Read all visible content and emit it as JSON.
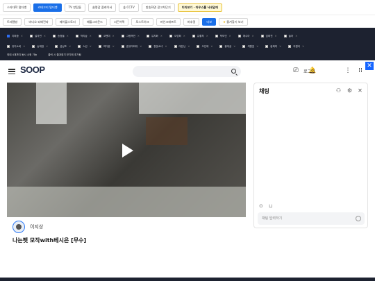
{
  "toolbar_top": {
    "buttons": [
      "스타대학 털더뱅",
      "카테고리 털더뱅",
      "TV 방탐들",
      "솔명감 플레이서",
      "숲 CCTV",
      "방송화면 광고차단기",
      "미리보기 · 마우스를 닉네임에"
    ]
  },
  "toolbar_second": {
    "buttons": [
      "트레젤방",
      "비디오 되배전자",
      "메이플스토리",
      "배틀그라운드",
      "서든어택",
      "로스트아크",
      "마인크래프트",
      "버추얼",
      "더보"
    ],
    "favorites_label": "즐겨찾기 보기"
  },
  "filter_panel": {
    "row1": [
      "지희중",
      "설국연",
      "송정들",
      "막리숲",
      "코밴미",
      "그림백연",
      "유지화",
      "오영희",
      "유좋처",
      "박보인",
      "에수아",
      "임희천",
      "솔아"
    ],
    "row2": [
      "유지소비",
      "송재현",
      "곰냥조",
      "스씬",
      "여다윤",
      "효유미와대",
      "창빛소녀",
      "대은난",
      "오인애",
      "봉대공",
      "섹원표",
      "람펴미",
      "의원이"
    ],
    "row3": [
      "최대 4개까지 동시 시청 가능",
      "클릭 시 즐겨찾기 보기에 추가됨"
    ]
  },
  "header": {
    "logo_text": "SOOP",
    "search_placeholder": "",
    "login_label": "로그인"
  },
  "video": {
    "streamer_name": "이지상",
    "title": "나는펫 모작with베시은 [무수]"
  },
  "chat": {
    "title": "채팅",
    "input_placeholder": "채팅 입력하기"
  },
  "colors": {
    "accent": "#1a6fe8",
    "dark_panel": "#1d2230"
  }
}
